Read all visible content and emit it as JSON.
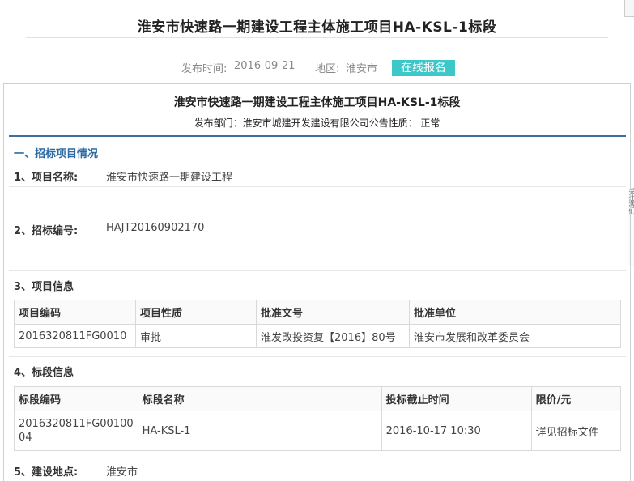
{
  "page": {
    "title": "淮安市快速路一期建设工程主体施工项目HA-KSL-1标段",
    "publish_label": "发布时间:",
    "publish_date": "2016-09-21",
    "region_label": "地区:",
    "region": "淮安市",
    "apply_button": "在线报名"
  },
  "notice": {
    "title": "淮安市快速路一期建设工程主体施工项目HA-KSL-1标段",
    "dept_line": "发布部门：淮安市城建开发建设有限公司公告性质： 正常",
    "side_tab": "关注我们"
  },
  "section1": {
    "heading": "一、招标项目情况",
    "project_name_label": "1、项目名称:",
    "project_name": "淮安市快速路一期建设工程",
    "bid_no_label": "2、招标编号:",
    "bid_no": "HAJT20160902170",
    "project_info_label": "3、项目信息",
    "project_table": {
      "headers": [
        "项目编码",
        "项目性质",
        "批准文号",
        "批准单位"
      ],
      "row": [
        "2016320811FG0010",
        "审批",
        "淮发改投资复【2016】80号",
        "淮安市发展和改革委员会"
      ]
    },
    "section_info_label": "4、标段信息",
    "section_table": {
      "headers": [
        "标段编码",
        "标段名称",
        "投标截止时间",
        "限价/元"
      ],
      "row_code_l1": "2016320811FG00100",
      "row_code_l2": "04",
      "row": [
        "HA-KSL-1",
        "2016-10-17 10:30",
        "详见招标文件"
      ]
    },
    "location_label": "5、建设地点:",
    "location": "淮安市"
  }
}
